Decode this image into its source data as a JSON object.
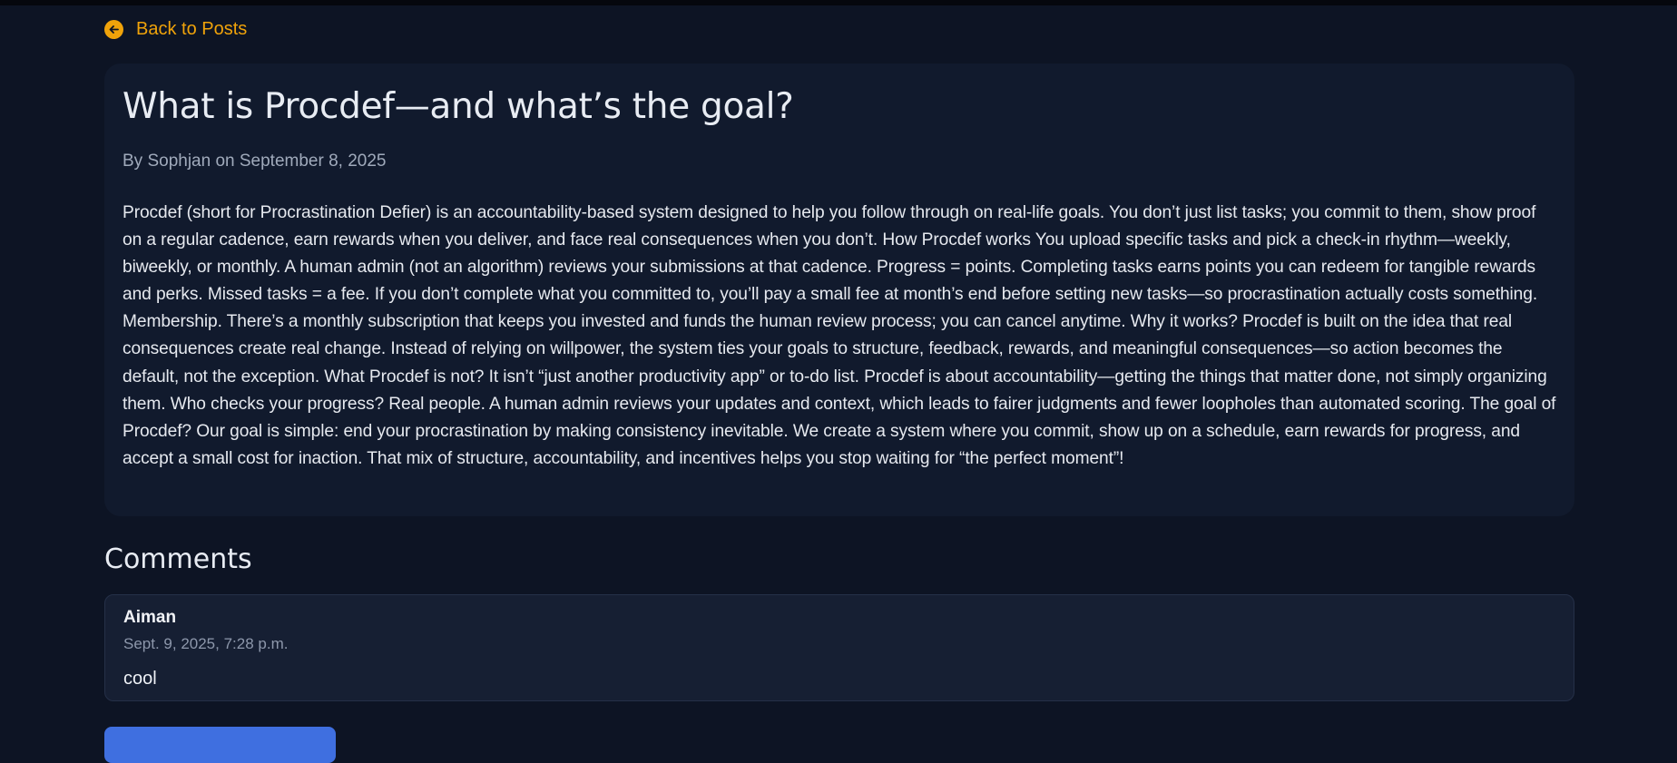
{
  "nav": {
    "back_label": "Back to Posts",
    "back_icon": "arrow-left-circle-icon"
  },
  "post": {
    "title": "What is Procdef—and what’s the goal?",
    "meta": "By Sophjan on September 8, 2025",
    "body": "Procdef (short for Procrastination Defier) is an accountability-based system designed to help you follow through on real-life goals. You don’t just list tasks; you commit to them, show proof on a regular cadence, earn rewards when you deliver, and face real consequences when you don’t. How Procdef works You upload specific tasks and pick a check-in rhythm—weekly, biweekly, or monthly. A human admin (not an algorithm) reviews your submissions at that cadence. Progress = points. Completing tasks earns points you can redeem for tangible rewards and perks. Missed tasks = a fee. If you don’t complete what you committed to, you’ll pay a small fee at month’s end before setting new tasks—so procrastination actually costs something. Membership. There’s a monthly subscription that keeps you invested and funds the human review process; you can cancel anytime. Why it works? Procdef is built on the idea that real consequences create real change. Instead of relying on willpower, the system ties your goals to structure, feedback, rewards, and meaningful consequences—so action becomes the default, not the exception. What Procdef is not? It isn’t “just another productivity app” or to-do list. Procdef is about accountability—getting the things that matter done, not simply organizing them. Who checks your progress? Real people. A human admin reviews your updates and context, which leads to fairer judgments and fewer loopholes than automated scoring. The goal of Procdef? Our goal is simple: end your procrastination by making consistency inevitable. We create a system where you commit, show up on a schedule, earn rewards for progress, and accept a small cost for inaction. That mix of structure, accountability, and incentives helps you stop waiting for “the perfect moment”!"
  },
  "comments": {
    "heading": "Comments",
    "items": [
      {
        "author": "Aiman",
        "date": "Sept. 9, 2025, 7:28 p.m.",
        "text": "cool"
      }
    ]
  },
  "colors": {
    "background": "#0d1424",
    "card": "#111a2d",
    "accent": "#f0a30a",
    "button": "#3f6fe0"
  }
}
